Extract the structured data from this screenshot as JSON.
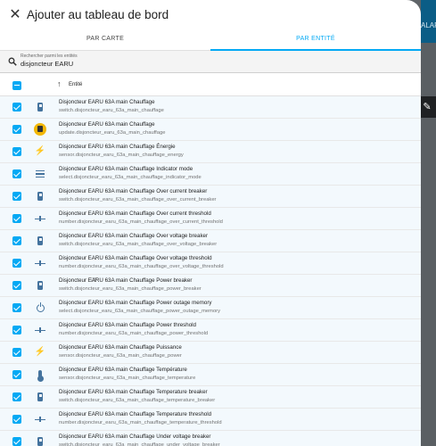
{
  "backdrop": {
    "alarm_text": "ALAR"
  },
  "dialog": {
    "title": "Ajouter au tableau de bord",
    "tabs": [
      "PAR CARTE",
      "PAR ENTITÉ"
    ],
    "active_tab": 1,
    "search": {
      "label": "Rechercher parmi les entités",
      "value": "disjoncteur EARU"
    },
    "column_header": "Entité",
    "accent_color": "#03a9f4",
    "icon_color": "#44739e"
  },
  "rows": [
    {
      "name": "Disjoncteur EARU 63A main Chauffage",
      "entity_id": "switch.disjoncteur_earu_63a_main_chauffage",
      "icon": "switch-icon"
    },
    {
      "name": "Disjoncteur EARU 63A main Chauffage",
      "entity_id": "update.disjoncteur_earu_63a_main_chauffage",
      "icon": "update-icon"
    },
    {
      "name": "Disjoncteur EARU 63A main Chauffage Énergie",
      "entity_id": "sensor.disjoncteur_earu_63a_main_chauffage_energy",
      "icon": "bolt-icon"
    },
    {
      "name": "Disjoncteur EARU 63A main Chauffage Indicator mode",
      "entity_id": "select.disjoncteur_earu_63a_main_chauffage_indicator_mode",
      "icon": "list-icon"
    },
    {
      "name": "Disjoncteur EARU 63A main Chauffage Over current breaker",
      "entity_id": "switch.disjoncteur_earu_63a_main_chauffage_over_current_breaker",
      "icon": "switch-icon"
    },
    {
      "name": "Disjoncteur EARU 63A main Chauffage Over current threshold",
      "entity_id": "number.disjoncteur_earu_63a_main_chauffage_over_current_threshold",
      "icon": "slider-icon"
    },
    {
      "name": "Disjoncteur EARU 63A main Chauffage Over voltage breaker",
      "entity_id": "switch.disjoncteur_earu_63a_main_chauffage_over_voltage_breaker",
      "icon": "switch-icon"
    },
    {
      "name": "Disjoncteur EARU 63A main Chauffage Over voltage threshold",
      "entity_id": "number.disjoncteur_earu_63a_main_chauffage_over_voltage_threshold",
      "icon": "slider-icon"
    },
    {
      "name": "Disjoncteur EARU 63A main Chauffage Power breaker",
      "entity_id": "switch.disjoncteur_earu_63a_main_chauffage_power_breaker",
      "icon": "switch-icon"
    },
    {
      "name": "Disjoncteur EARU 63A main Chauffage Power outage memory",
      "entity_id": "select.disjoncteur_earu_63a_main_chauffage_power_outage_memory",
      "icon": "power-icon"
    },
    {
      "name": "Disjoncteur EARU 63A main Chauffage Power threshold",
      "entity_id": "number.disjoncteur_earu_63a_main_chauffage_power_threshold",
      "icon": "slider-icon"
    },
    {
      "name": "Disjoncteur EARU 63A main Chauffage Puissance",
      "entity_id": "sensor.disjoncteur_earu_63a_main_chauffage_power",
      "icon": "bolt-icon"
    },
    {
      "name": "Disjoncteur EARU 63A main Chauffage Température",
      "entity_id": "sensor.disjoncteur_earu_63a_main_chauffage_temperature",
      "icon": "thermometer-icon"
    },
    {
      "name": "Disjoncteur EARU 63A main Chauffage Temperature breaker",
      "entity_id": "switch.disjoncteur_earu_63a_main_chauffage_temperature_breaker",
      "icon": "switch-icon"
    },
    {
      "name": "Disjoncteur EARU 63A main Chauffage Temperature threshold",
      "entity_id": "number.disjoncteur_earu_63a_main_chauffage_temperature_threshold",
      "icon": "slider-icon"
    },
    {
      "name": "Disjoncteur EARU 63A main Chauffage Under voltage breaker",
      "entity_id": "switch.disjoncteur_earu_63a_main_chauffage_under_voltage_breaker",
      "icon": "switch-icon"
    }
  ]
}
